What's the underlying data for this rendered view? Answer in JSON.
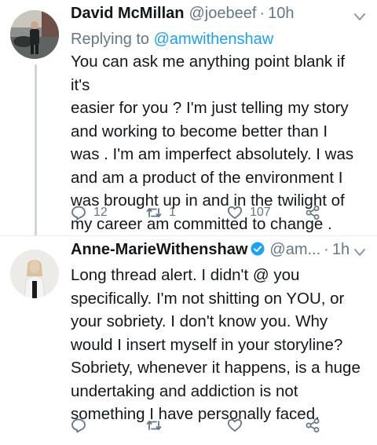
{
  "tweets": [
    {
      "name": "David McMillan",
      "handle": "@joebeef",
      "dot": "·",
      "time": "10h",
      "reply_prefix": "Replying to",
      "reply_to": "@amwithenshaw",
      "lines": [
        "You can ask me anything point blank if it's",
        "easier for you ? I'm just telling my story",
        "and working to become better than I",
        "was . I'm am imperfect absolutely. I was",
        "and am a product of the environment I",
        "was brought up in and in the twilight of",
        "my career am committed to change ."
      ],
      "replies": "12",
      "retweets": "1",
      "likes": "107"
    },
    {
      "name": "Anne-MarieWithenshaw",
      "handle": "@am...",
      "dot": "·",
      "time": "1h",
      "verified": true,
      "lines": [
        "Long thread alert. I didn't @ you",
        "specifically. I'm not shitting on YOU, or",
        "your sobriety. I don't know you. Why",
        "would I insert myself in your storyline?",
        "Sobriety, whenever it happens, is a huge",
        "undertaking and addiction is not",
        "something I have personally faced."
      ]
    }
  ],
  "colors": {
    "accent": "#1da1f2",
    "secondary": "#657786",
    "text": "#14171a"
  }
}
